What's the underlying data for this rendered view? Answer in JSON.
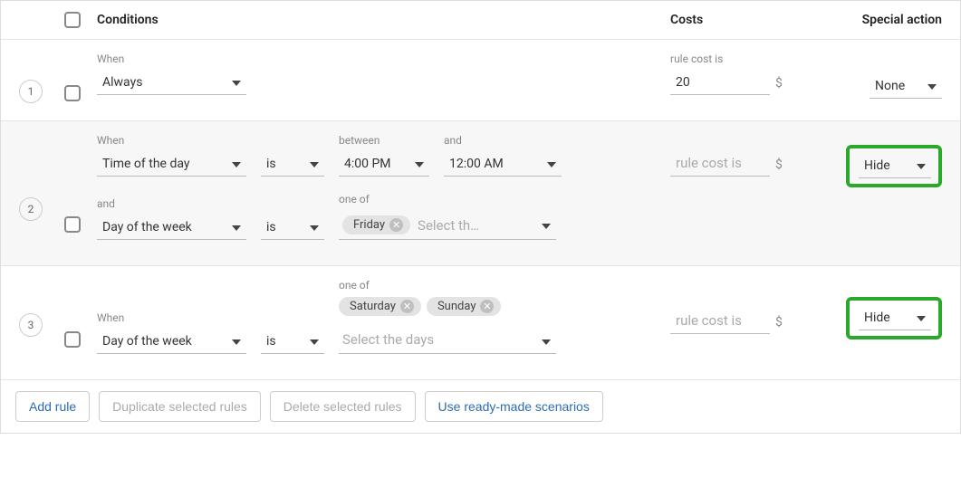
{
  "header": {
    "conditions": "Conditions",
    "costs": "Costs",
    "special_action": "Special action"
  },
  "labels": {
    "when": "When",
    "and": "and",
    "between": "between",
    "one_of": "one of",
    "is": "is",
    "rule_cost_is": "rule cost is",
    "select_days": "Select the days",
    "select_th": "Select th…",
    "currency": "$"
  },
  "rules": [
    {
      "index": "1",
      "condition_type": "Always",
      "cost_value": "20",
      "action": "None"
    },
    {
      "index": "2",
      "cond1_type": "Time of the day",
      "cond1_from": "4:00 PM",
      "cond1_to": "12:00 AM",
      "cond2_type": "Day of the week",
      "cond2_chip1": "Friday",
      "cost_placeholder": "rule cost is",
      "action": "Hide"
    },
    {
      "index": "3",
      "cond_type": "Day of the week",
      "chip1": "Saturday",
      "chip2": "Sunday",
      "cost_placeholder": "rule cost is",
      "action": "Hide"
    }
  ],
  "footer": {
    "add": "Add rule",
    "dup": "Duplicate selected rules",
    "del": "Delete selected rules",
    "ready": "Use ready-made scenarios"
  }
}
